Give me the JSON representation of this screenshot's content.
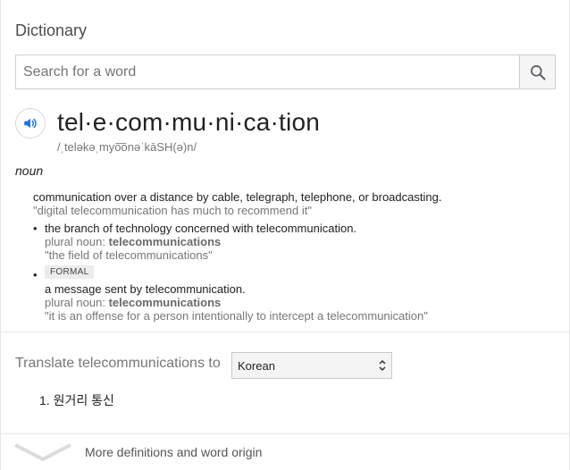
{
  "card": {
    "title": "Dictionary"
  },
  "search": {
    "placeholder": "Search for a word",
    "value": ""
  },
  "entry": {
    "headword": "tel·e·com·mu·ni·ca·tion",
    "phonetic": "/ˌteləkəˌmyo͞onəˈkāSH(ə)n/",
    "part_of_speech": "noun",
    "senses": [
      {
        "definition": "communication over a distance by cable, telegraph, telephone, or broadcasting.",
        "example": "\"digital telecommunication has much to recommend it\""
      },
      {
        "definition": "the branch of technology concerned with telecommunication.",
        "plural_label": "plural noun: ",
        "plural_word": "telecommunications",
        "example": "\"the field of telecommunications\""
      },
      {
        "register": "FORMAL",
        "definition": "a message sent by telecommunication.",
        "plural_label": "plural noun: ",
        "plural_word": "telecommunications",
        "example": "\"it is an offense for a person intentionally to intercept a telecommunication\""
      }
    ]
  },
  "translate": {
    "label": "Translate telecommunications to",
    "language": "Korean",
    "results": [
      "1. 원거리 통신"
    ]
  },
  "more": {
    "label": "More definitions and word origin"
  },
  "bullet_glyph": "•",
  "icons": {
    "search": "search-icon",
    "speaker": "speaker-icon",
    "dropdown": "dropdown-arrows-icon",
    "chevron": "chevron-down-icon"
  },
  "colors": {
    "accent": "#1a73e8",
    "muted": "#777777"
  }
}
